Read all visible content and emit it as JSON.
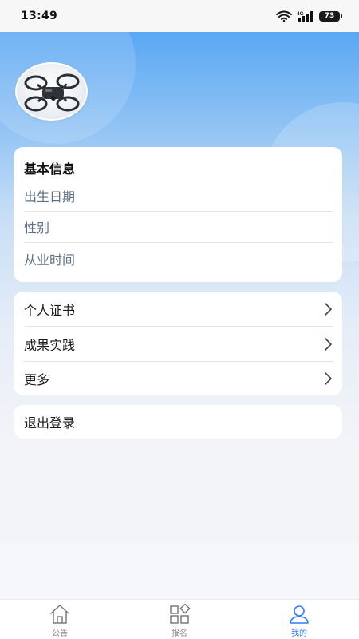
{
  "status_bar": {
    "time": "13:49",
    "network": "4G",
    "battery": "73"
  },
  "profile": {
    "avatar_icon": "drone-avatar-icon"
  },
  "basic_info": {
    "title": "基本信息",
    "rows": [
      {
        "label": "出生日期"
      },
      {
        "label": "性别"
      },
      {
        "label": "从业时间"
      }
    ]
  },
  "menu": {
    "items": [
      {
        "label": "个人证书",
        "icon": "chevron-right-icon"
      },
      {
        "label": "成果实践",
        "icon": "chevron-right-icon"
      },
      {
        "label": "更多",
        "icon": "chevron-right-icon"
      }
    ]
  },
  "logout": {
    "label": "退出登录"
  },
  "tabbar": {
    "items": [
      {
        "label": "公告",
        "icon": "home-icon",
        "active": false
      },
      {
        "label": "报名",
        "icon": "grid-icon",
        "active": false
      },
      {
        "label": "我的",
        "icon": "user-icon",
        "active": true
      }
    ]
  },
  "colors": {
    "accent": "#2f7cf6",
    "header_blue": "#5aa7f4",
    "background": "#f3f4f8",
    "muted_text": "#5d6e88"
  }
}
